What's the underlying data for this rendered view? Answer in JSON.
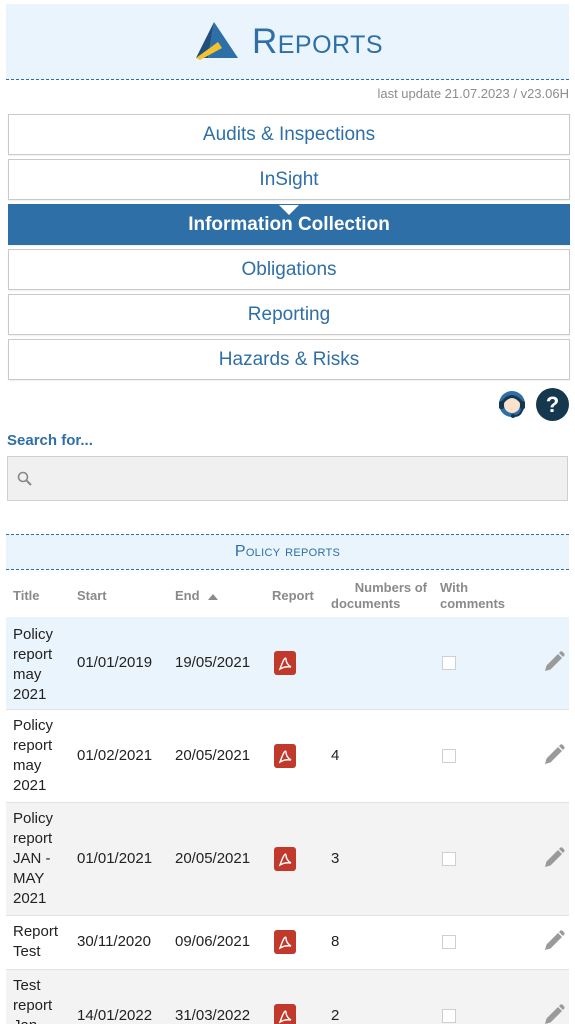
{
  "header": {
    "title": "Reports"
  },
  "last_update": "last update 21.07.2023 / v23.06H",
  "menu": [
    {
      "label": "Audits & Inspections",
      "active": false
    },
    {
      "label": "InSight",
      "active": false
    },
    {
      "label": "Information Collection",
      "active": true
    },
    {
      "label": "Obligations",
      "active": false
    },
    {
      "label": "Reporting",
      "active": false
    },
    {
      "label": "Hazards & Risks",
      "active": false
    }
  ],
  "help": {
    "symbol": "?"
  },
  "search": {
    "label": "Search for...",
    "value": "",
    "placeholder": ""
  },
  "section": {
    "title": "Policy reports"
  },
  "table": {
    "headers": {
      "title": "Title",
      "start": "Start",
      "end": "End",
      "report": "Report",
      "numbers_line1": "Numbers of",
      "numbers_line2": "documents",
      "with_line1": "With",
      "with_line2": "comments"
    },
    "sorted_column": "end",
    "rows": [
      {
        "title_lines": [
          "Policy",
          "report",
          "may",
          "2021"
        ],
        "start": "01/01/2019",
        "end": "19/05/2021",
        "documents": "",
        "with_comments": false
      },
      {
        "title_lines": [
          "Policy",
          "report",
          "may",
          "2021"
        ],
        "start": "01/02/2021",
        "end": "20/05/2021",
        "documents": "4",
        "with_comments": false
      },
      {
        "title_lines": [
          "Policy",
          "report",
          "JAN -",
          "MAY",
          "2021"
        ],
        "start": "01/01/2021",
        "end": "20/05/2021",
        "documents": "3",
        "with_comments": false
      },
      {
        "title_lines": [
          "Report",
          "Test"
        ],
        "start": "30/11/2020",
        "end": "09/06/2021",
        "documents": "8",
        "with_comments": false
      },
      {
        "title_lines": [
          "Test",
          "report",
          "Jan"
        ],
        "start": "14/01/2022",
        "end": "31/03/2022",
        "documents": "2",
        "with_comments": false
      }
    ]
  },
  "colors": {
    "brand_blue": "#2e6fa7",
    "header_bg": "#eaf4fc",
    "pdf_red": "#c0392b",
    "help_dark": "#16384f"
  }
}
